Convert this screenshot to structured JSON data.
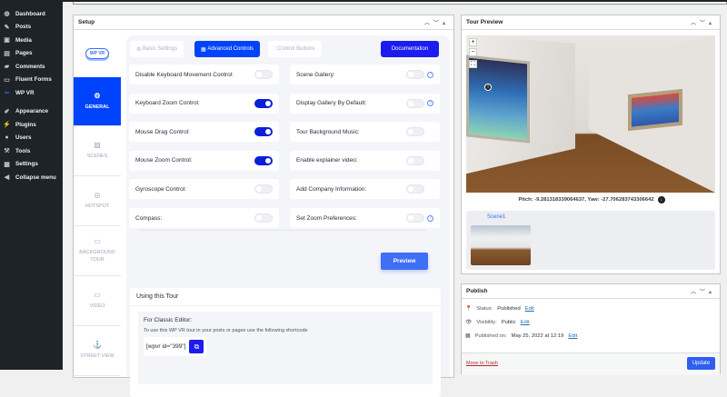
{
  "admin_menu": [
    {
      "label": "Dashboard",
      "icon": "dashboard-icon",
      "glyph": "◍"
    },
    {
      "label": "Posts",
      "icon": "pin-icon",
      "glyph": "✎"
    },
    {
      "label": "Media",
      "icon": "media-icon",
      "glyph": "▣"
    },
    {
      "label": "Pages",
      "icon": "pages-icon",
      "glyph": "▤"
    },
    {
      "label": "Comments",
      "icon": "comment-icon",
      "glyph": "▰"
    },
    {
      "label": "Fluent Forms",
      "icon": "form-icon",
      "glyph": "▭"
    },
    {
      "label": "WP VR",
      "icon": "vr-icon",
      "glyph": "∞"
    },
    {
      "label": "Appearance",
      "icon": "brush-icon",
      "glyph": "✐"
    },
    {
      "label": "Plugins",
      "icon": "plugin-icon",
      "glyph": "⚡"
    },
    {
      "label": "Users",
      "icon": "user-icon",
      "glyph": "●"
    },
    {
      "label": "Tools",
      "icon": "wrench-icon",
      "glyph": "⚒"
    },
    {
      "label": "Settings",
      "icon": "settings-icon",
      "glyph": "▦"
    },
    {
      "label": "Collapse menu",
      "icon": "collapse-icon",
      "glyph": "◀"
    }
  ],
  "setup": {
    "title": "Setup",
    "logo": "WP VR",
    "vtabs": [
      {
        "label": "GENERAL",
        "glyph": "⚙"
      },
      {
        "label": "SCENES",
        "glyph": "▨"
      },
      {
        "label": "HOTSPOT",
        "glyph": "◎"
      },
      {
        "label": "BACKGROUND TOUR",
        "glyph": "▭"
      },
      {
        "label": "VIDEO",
        "glyph": "▭"
      },
      {
        "label": "STREET VIEW",
        "glyph": "⚓"
      }
    ],
    "tabs": {
      "basic": "Basic Settings",
      "advanced": "Advanced Controls",
      "control": "Control Buttons",
      "documentation": "Documentation"
    },
    "left_controls": [
      {
        "label": "Disable Keyboard Movement Control:",
        "on": false
      },
      {
        "label": "Keyboard Zoom Control:",
        "on": true
      },
      {
        "label": "Mouse Drag Control:",
        "on": true
      },
      {
        "label": "Mouse Zoom Control:",
        "on": true
      },
      {
        "label": "Gyroscope Control:",
        "on": false
      },
      {
        "label": "Compass:",
        "on": false
      }
    ],
    "right_controls": [
      {
        "label": "Scene Gallery:",
        "on": false,
        "help": true
      },
      {
        "label": "Display Gallery By Default:",
        "on": false,
        "help": true
      },
      {
        "label": "Tour Background Music:",
        "on": false,
        "help": false
      },
      {
        "label": "Enable explainer video:",
        "on": false,
        "help": false
      },
      {
        "label": "Add Company Information:",
        "on": false,
        "help": false
      },
      {
        "label": "Set Zoom Preferences:",
        "on": false,
        "help": true
      }
    ],
    "preview_label": "Preview",
    "using": {
      "title": "Using this Tour",
      "classic_title": "For Classic Editor:",
      "classic_desc": "To use this WP VR tour in your posts or pages use the following shortcode",
      "shortcode": "[wpvr id=\"399\"]"
    }
  },
  "tour_preview": {
    "title": "Tour Preview",
    "coords": "Pitch: -9.281318339064637, Yaw: -27.706283743306642",
    "scene": "Scene1"
  },
  "publish": {
    "title": "Publish",
    "status_label": "Status:",
    "status": "Published",
    "visibility_label": "Visibility:",
    "visibility": "Public",
    "published_label": "Published on:",
    "published": "May 25, 2022 at 12:19",
    "edit": "Edit",
    "trash": "Move to Trash",
    "update": "Update"
  }
}
